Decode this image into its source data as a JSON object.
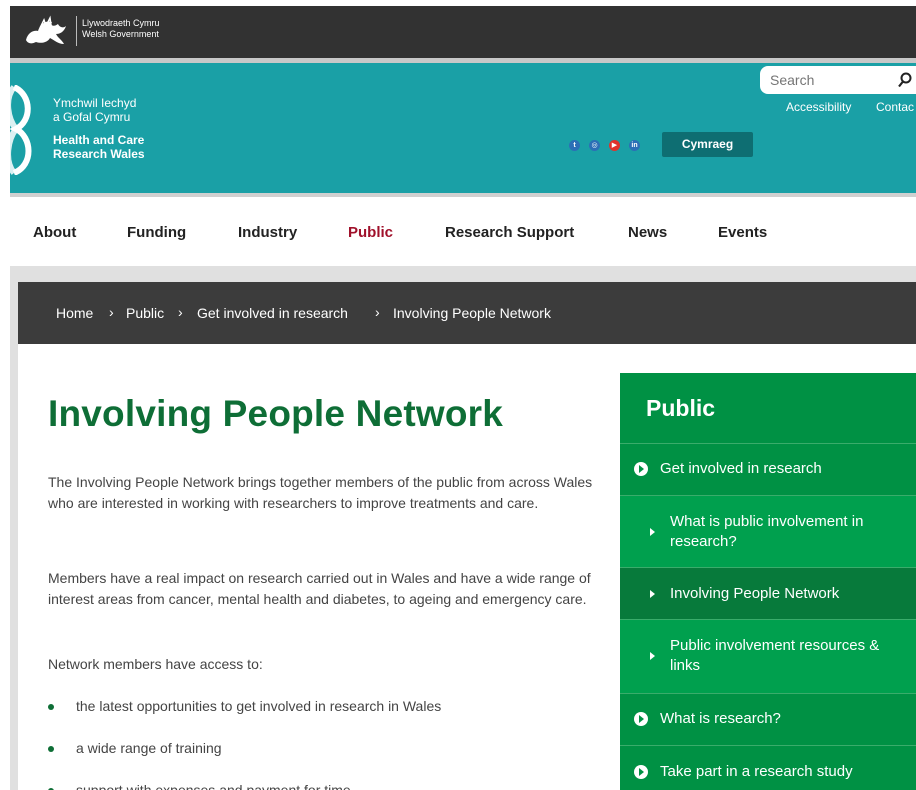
{
  "gov_bar": {
    "line1": "Llywodraeth Cymru",
    "line2": "Welsh Government"
  },
  "header": {
    "logo_lines": [
      "Ymchwil Iechyd",
      "a Gofal Cymru",
      "Health and Care",
      "Research Wales"
    ],
    "accessibility": "Accessibility",
    "contact": "Contac",
    "social_icons": [
      "twitter-icon",
      "instagram-icon",
      "youtube-icon",
      "linkedin-icon"
    ],
    "social_glyphs": [
      "t",
      "◎",
      "▶",
      "in"
    ],
    "language_button": "Cymraeg",
    "search_placeholder": "Search"
  },
  "nav": {
    "items": [
      "About",
      "Funding",
      "Industry",
      "Public",
      "Research Support",
      "News",
      "Events"
    ],
    "active": "Public"
  },
  "breadcrumb": [
    "Home",
    "Public",
    "Get involved in research",
    "Involving People Network"
  ],
  "breadcrumb_separator": "›",
  "article": {
    "title": "Involving People Network",
    "paragraphs": [
      "The Involving People Network brings together members of the public from across Wales who are interested in working with researchers to improve treatments and care.",
      "Members have a real impact on research carried out in Wales and have a wide range of interest areas from cancer, mental health and diabetes, to ageing and emergency care.",
      "Network members have access to:"
    ],
    "bullets": [
      "the latest opportunities to get involved in research in Wales",
      "a wide range of training",
      "support with expenses and payment for time"
    ]
  },
  "sidebar": {
    "title": "Public",
    "items": [
      {
        "label": "Get involved in research",
        "level": "top"
      },
      {
        "label": "What is public involvement in research?",
        "level": "sub"
      },
      {
        "label": "Involving People Network",
        "level": "current"
      },
      {
        "label": "Public involvement resources & links",
        "level": "sub"
      },
      {
        "label": "What is research?",
        "level": "top"
      },
      {
        "label": "Take part in a research study",
        "level": "top"
      }
    ]
  },
  "colors": {
    "gov_bar": "#323232",
    "header_teal": "#1aa0a6",
    "nav_active": "#a0112b",
    "title_green": "#0e6e36",
    "sidebar_green": "#009144",
    "breadcrumb_bg": "#3c3c3c"
  }
}
